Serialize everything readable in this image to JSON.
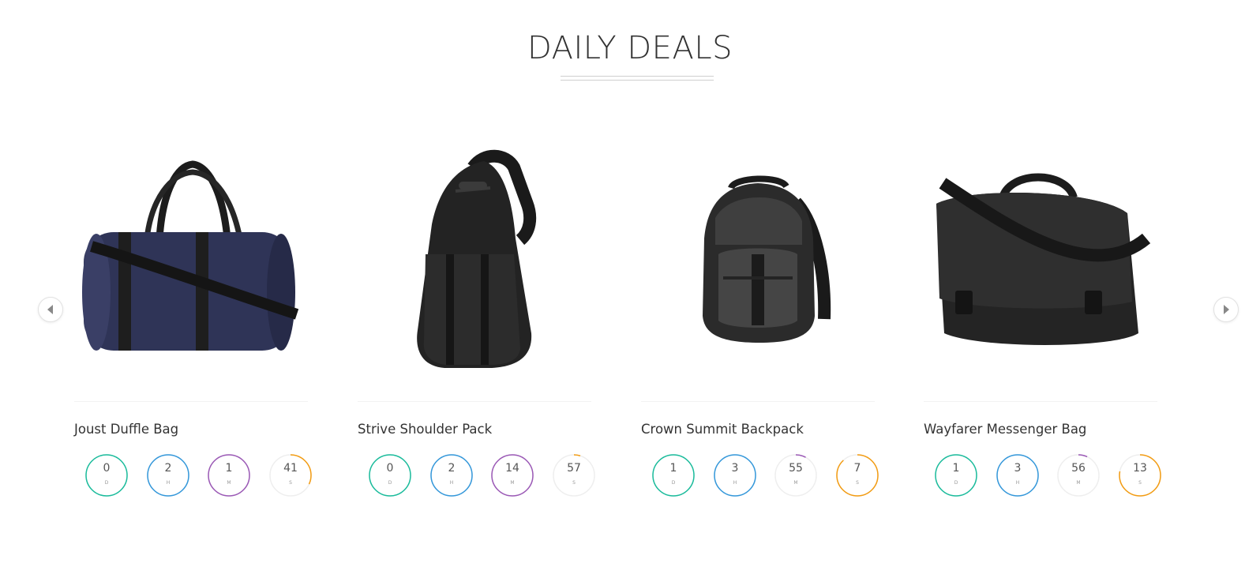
{
  "section": {
    "title": "DAILY DEALS"
  },
  "carousel": {
    "prev_icon": "triangle-left",
    "next_icon": "triangle-right"
  },
  "timer_units": {
    "days": "D",
    "hours": "H",
    "minutes": "M",
    "seconds": "S"
  },
  "timer_colors": {
    "days": "#1abc9c",
    "hours": "#3498db",
    "minutes": "#9b59b6",
    "seconds": "#f39c12"
  },
  "products": [
    {
      "name": "Joust Duffle Bag",
      "image": "navy-duffle-bag",
      "countdown": {
        "days": "0",
        "hours": "2",
        "minutes": "1",
        "seconds": "41"
      },
      "progress": {
        "days": 1.0,
        "hours": 1.0,
        "minutes": 1.0,
        "seconds": 0.32
      }
    },
    {
      "name": "Strive Shoulder Pack",
      "image": "black-sling-pack",
      "countdown": {
        "days": "0",
        "hours": "2",
        "minutes": "14",
        "seconds": "57"
      },
      "progress": {
        "days": 1.0,
        "hours": 1.0,
        "minutes": 1.0,
        "seconds": 0.05
      }
    },
    {
      "name": "Crown Summit Backpack",
      "image": "grey-black-backpack",
      "countdown": {
        "days": "1",
        "hours": "3",
        "minutes": "55",
        "seconds": "7"
      },
      "progress": {
        "days": 1.0,
        "hours": 1.0,
        "minutes": 0.08,
        "seconds": 0.88
      }
    },
    {
      "name": "Wayfarer Messenger Bag",
      "image": "black-messenger-bag",
      "countdown": {
        "days": "1",
        "hours": "3",
        "minutes": "56",
        "seconds": "13"
      },
      "progress": {
        "days": 1.0,
        "hours": 1.0,
        "minutes": 0.07,
        "seconds": 0.78
      }
    }
  ]
}
